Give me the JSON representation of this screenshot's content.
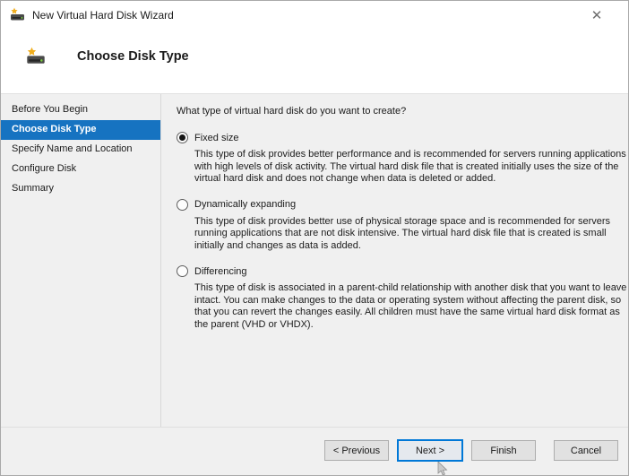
{
  "window": {
    "title": "New Virtual Hard Disk Wizard",
    "close_glyph": "✕"
  },
  "header": {
    "title": "Choose Disk Type"
  },
  "sidebar": {
    "items": [
      {
        "label": "Before You Begin",
        "selected": false
      },
      {
        "label": "Choose Disk Type",
        "selected": true
      },
      {
        "label": "Specify Name and Location",
        "selected": false
      },
      {
        "label": "Configure Disk",
        "selected": false
      },
      {
        "label": "Summary",
        "selected": false
      }
    ]
  },
  "main": {
    "question": "What type of virtual hard disk do you want to create?",
    "options": [
      {
        "label": "Fixed size",
        "selected": true,
        "description": "This type of disk provides better performance and is recommended for servers running applications with high levels of disk activity. The virtual hard disk file that is created initially uses the size of the virtual hard disk and does not change when data is deleted or added."
      },
      {
        "label": "Dynamically expanding",
        "selected": false,
        "description": "This type of disk provides better use of physical storage space and is recommended for servers running applications that are not disk intensive. The virtual hard disk file that is created is small initially and changes as data is added."
      },
      {
        "label": "Differencing",
        "selected": false,
        "description": "This type of disk is associated in a parent-child relationship with another disk that you want to leave intact. You can make changes to the data or operating system without affecting the parent disk, so that you can revert the changes easily. All children must have the same virtual hard disk format as the parent (VHD or VHDX)."
      }
    ]
  },
  "footer": {
    "buttons": [
      {
        "label": "< Previous"
      },
      {
        "label": "Next >"
      },
      {
        "label": "Finish"
      },
      {
        "label": "Cancel"
      }
    ]
  },
  "colors": {
    "selection_blue": "#1673c1",
    "focus_blue": "#0078d7",
    "body_bg": "#f0f0f0",
    "button_bg": "#e1e1e1",
    "disk_dark": "#4a4a4a",
    "disk_led_green": "#7ac943",
    "star_yellow": "#f0ad1d"
  }
}
